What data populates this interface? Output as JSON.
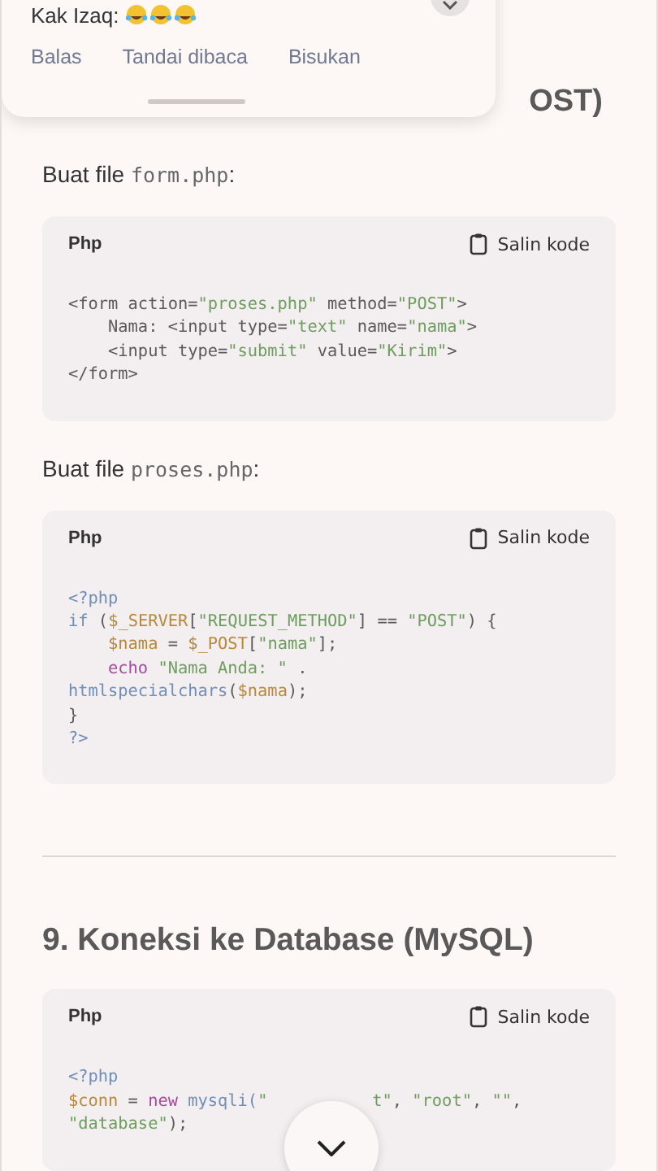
{
  "notification": {
    "message": "Kak Izaq:",
    "actions": [
      {
        "label": "Balas"
      },
      {
        "label": "Tandai dibaca"
      },
      {
        "label": "Bisukan"
      }
    ]
  },
  "section_8": {
    "heading_visible": "OST)"
  },
  "blocks": [
    {
      "kind": "paragraph",
      "prefix": "Buat file ",
      "code": "form.php",
      "suffix": ":"
    },
    {
      "kind": "code",
      "language": "Php",
      "copy_label": "Salin kode",
      "lines": [
        [
          {
            "t": "<form action=",
            "kind": "plain"
          },
          {
            "t": "\"proses.php\"",
            "kind": "string"
          },
          {
            "t": " method=",
            "kind": "plain"
          },
          {
            "t": "\"POST\"",
            "kind": "string"
          },
          {
            "t": ">",
            "kind": "plain"
          }
        ],
        [
          {
            "t": "    Nama: <input type=",
            "kind": "plain"
          },
          {
            "t": "\"text\"",
            "kind": "string"
          },
          {
            "t": " name=",
            "kind": "plain"
          },
          {
            "t": "\"nama\"",
            "kind": "string"
          },
          {
            "t": ">",
            "kind": "plain"
          }
        ],
        [
          {
            "t": "    <input type=",
            "kind": "plain"
          },
          {
            "t": "\"submit\"",
            "kind": "string"
          },
          {
            "t": " value=",
            "kind": "plain"
          },
          {
            "t": "\"Kirim\"",
            "kind": "string"
          },
          {
            "t": ">",
            "kind": "plain"
          }
        ],
        [
          {
            "t": "</form>",
            "kind": "plain"
          }
        ]
      ]
    },
    {
      "kind": "paragraph",
      "prefix": "Buat file ",
      "code": "proses.php",
      "suffix": ":"
    },
    {
      "kind": "code",
      "language": "Php",
      "copy_label": "Salin kode",
      "lines": [
        [
          {
            "t": "<?php",
            "kind": "meta"
          }
        ],
        [
          {
            "t": "if",
            "kind": "meta"
          },
          {
            "t": " (",
            "kind": "plain"
          },
          {
            "t": "$_SERVER",
            "kind": "variable"
          },
          {
            "t": "[",
            "kind": "plain"
          },
          {
            "t": "\"REQUEST_METHOD\"",
            "kind": "string"
          },
          {
            "t": "] == ",
            "kind": "plain"
          },
          {
            "t": "\"POST\"",
            "kind": "string"
          },
          {
            "t": ") {",
            "kind": "plain"
          }
        ],
        [
          {
            "t": "    $nama",
            "kind": "variable"
          },
          {
            "t": " = ",
            "kind": "plain"
          },
          {
            "t": "$_POST",
            "kind": "variable"
          },
          {
            "t": "[",
            "kind": "plain"
          },
          {
            "t": "\"nama\"",
            "kind": "string"
          },
          {
            "t": "];",
            "kind": "plain"
          }
        ],
        [
          {
            "t": "    echo",
            "kind": "keyword"
          },
          {
            "t": " \"Nama Anda: \"",
            "kind": "string"
          },
          {
            "t": " .",
            "kind": "plain"
          }
        ],
        [
          {
            "t": "htmlspecialchars",
            "kind": "meta"
          },
          {
            "t": "(",
            "kind": "plain"
          },
          {
            "t": "$nama",
            "kind": "variable"
          },
          {
            "t": ");",
            "kind": "plain"
          }
        ],
        [
          {
            "t": "}",
            "kind": "plain"
          }
        ],
        [
          {
            "t": "?>",
            "kind": "meta"
          }
        ]
      ]
    },
    {
      "kind": "divider"
    },
    {
      "kind": "heading",
      "text": "9. Koneksi ke Database (MySQL)"
    },
    {
      "kind": "code",
      "language": "Php",
      "copy_label": "Salin kode",
      "lines": [
        [
          {
            "t": "<?php",
            "kind": "meta"
          }
        ],
        [
          {
            "t": "$conn",
            "kind": "variable"
          },
          {
            "t": " = ",
            "kind": "plain"
          },
          {
            "t": "new",
            "kind": "keyword"
          },
          {
            "t": " mysqli(",
            "kind": "meta"
          },
          {
            "t": "\"",
            "kind": "string"
          },
          {
            "t": "t\"",
            "kind": "string",
            "gap": true
          },
          {
            "t": ", ",
            "kind": "plain"
          },
          {
            "t": "\"root\"",
            "kind": "string"
          },
          {
            "t": ", ",
            "kind": "plain"
          },
          {
            "t": "\"\"",
            "kind": "string"
          },
          {
            "t": ",",
            "kind": "plain"
          }
        ],
        [
          {
            "t": "\"database\"",
            "kind": "string"
          },
          {
            "t": ");",
            "kind": "plain"
          }
        ]
      ]
    }
  ]
}
